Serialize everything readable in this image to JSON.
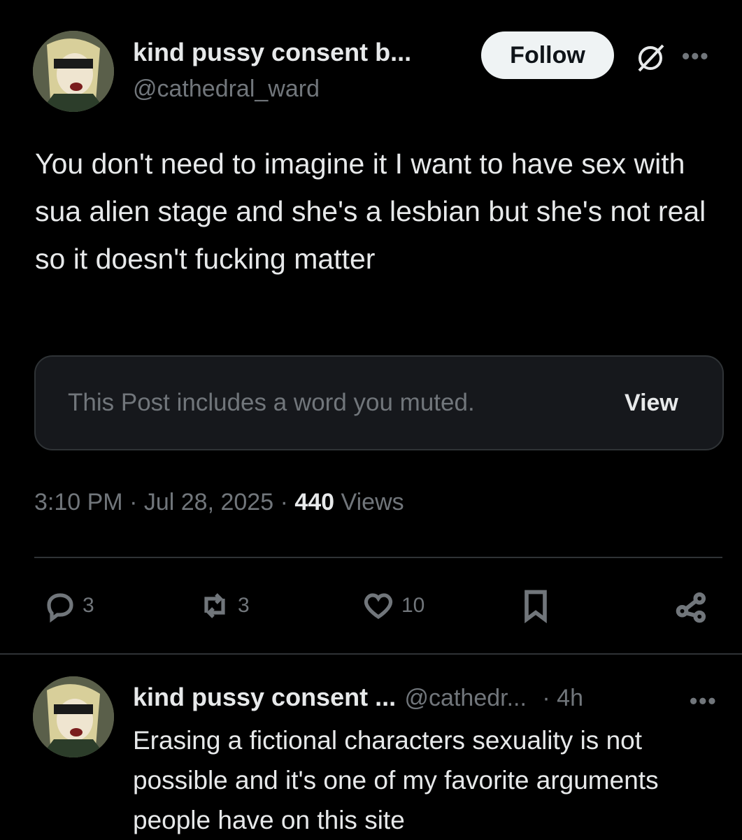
{
  "tweet": {
    "author_name": "kind pussy consent b...",
    "author_handle": "@cathedral_ward",
    "follow_label": "Follow",
    "more_label": "•••",
    "body": "You don't need to imagine it I want to have sex with sua alien stage and she's a lesbian but she's not real so it doesn't fucking matter",
    "muted_notice": "This Post includes a word you muted.",
    "view_label": "View",
    "time": "3:10 PM",
    "date": "Jul 28, 2025",
    "views_count": "440",
    "views_label": "Views",
    "sep": "·",
    "actions": {
      "replies": "3",
      "reposts": "3",
      "likes": "10"
    }
  },
  "reply": {
    "author_name": "kind pussy consent ...",
    "author_handle": "@cathedr...",
    "time": "· 4h",
    "more_label": "•••",
    "body": "Erasing a fictional characters sexuality is not possible and it's one of my favorite arguments people have on this site"
  },
  "icons": [
    "avatar",
    "grok-icon",
    "more-icon",
    "reply-icon",
    "repost-icon",
    "like-icon",
    "bookmark-icon",
    "share-icon"
  ]
}
